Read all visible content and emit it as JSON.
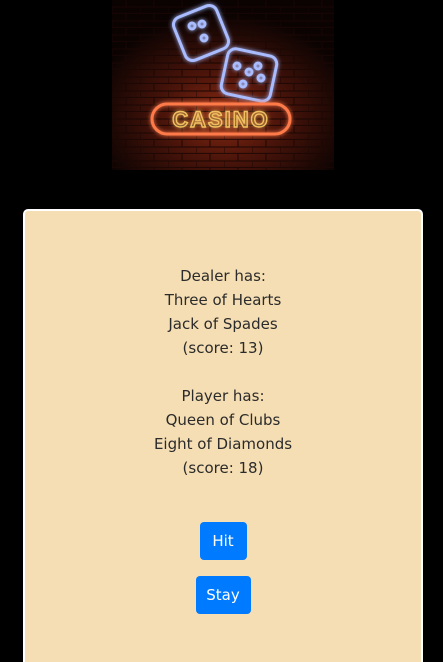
{
  "banner": {
    "sign_text": "CASINO"
  },
  "dealer": {
    "heading": "Dealer has:",
    "cards": [
      "Three of Hearts",
      "Jack of Spades"
    ],
    "score_text": "(score: 13)"
  },
  "player": {
    "heading": "Player has:",
    "cards": [
      "Queen of Clubs",
      "Eight of Diamonds"
    ],
    "score_text": "(score: 18)"
  },
  "actions": {
    "hit_label": "Hit",
    "stay_label": "Stay"
  },
  "colors": {
    "page_background": "#000000",
    "card_background": "#f5deb3",
    "button": "#007bff",
    "neon_dice": "#9fb6ff",
    "neon_sign": "#f0c060"
  }
}
